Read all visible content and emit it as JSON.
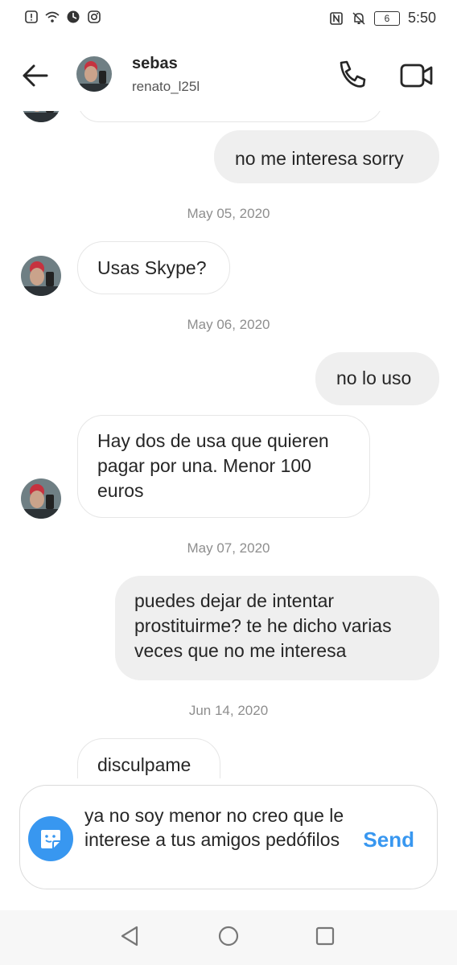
{
  "status_bar": {
    "time": "5:50",
    "battery": "6"
  },
  "header": {
    "name": "sebas",
    "username": "renato_l25l"
  },
  "messages": [
    {
      "type": "out",
      "text": "no me interesa sorry"
    },
    {
      "type": "date",
      "text": "May 05, 2020"
    },
    {
      "type": "in",
      "text": "Usas Skype?"
    },
    {
      "type": "date",
      "text": "May 06, 2020"
    },
    {
      "type": "out",
      "text": "no lo uso"
    },
    {
      "type": "in",
      "text": "Hay dos de usa que quieren pagar por una. Menor 100 euros"
    },
    {
      "type": "date",
      "text": "May 07, 2020"
    },
    {
      "type": "out",
      "text": "puedes dejar de intentar prostituirme? te he dicho varias veces que no me interesa"
    },
    {
      "type": "date",
      "text": "Jun 14, 2020"
    },
    {
      "type": "in",
      "text": "disculpame"
    }
  ],
  "composer": {
    "text": "ya no soy menor no creo que le interese a tus amigos pedófilos",
    "send_label": "Send"
  },
  "icons": {
    "back": "arrow-left-icon",
    "call": "phone-icon",
    "video": "video-camera-icon",
    "sticker": "sticker-icon",
    "nav_back": "triangle-back-icon",
    "nav_home": "circle-home-icon",
    "nav_recent": "square-recent-icon"
  },
  "colors": {
    "accent": "#3897f0",
    "outgoing_bubble": "#efefef",
    "date_text": "#8e8e8e"
  }
}
